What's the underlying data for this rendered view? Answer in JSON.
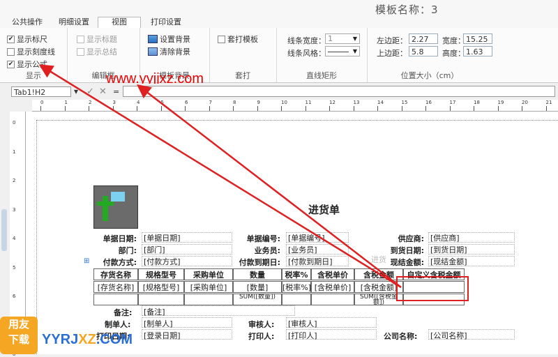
{
  "window": {
    "title": "模板名称：3"
  },
  "tabs": [
    {
      "label": "公共操作",
      "active": false
    },
    {
      "label": "明细设置",
      "active": false
    },
    {
      "label": "视图",
      "active": true
    },
    {
      "label": "打印设置",
      "active": false
    }
  ],
  "ribbon": {
    "display": {
      "label": "显示",
      "show_ruler": "显示标尺",
      "show_scale_line": "显示刻度线",
      "show_formula": "显示公式",
      "show_title": "显示标题",
      "show_summary": "显示总结"
    },
    "edit": {
      "label": "编辑框"
    },
    "bg": {
      "label": "模板背景",
      "set_bg": "设置背景",
      "clear_bg": "清除背景"
    },
    "overlay": {
      "label": "套打",
      "overlay_template": "套打模板"
    },
    "lines": {
      "label": "直线矩形",
      "width_label": "线条宽度：",
      "width_value": "1",
      "style_label": "线条风格："
    },
    "position": {
      "label": "位置大小（cm）",
      "left_label": "左边距：",
      "left_value": "2.27",
      "width_label": "宽度：",
      "width_value": "15.25",
      "top_label": "上边距：",
      "top_value": "5.8",
      "height_label": "高度：",
      "height_value": "1.63"
    }
  },
  "formula_bar": {
    "cell_ref": "Tab1!H2",
    "eq": "="
  },
  "ruler": {
    "h_ticks": [
      "0",
      "1",
      "2",
      "3",
      "4",
      "5",
      "6",
      "7",
      "8",
      "9",
      "10",
      "11",
      "12",
      "13",
      "14",
      "15",
      "16",
      "17",
      "18",
      "19",
      "20",
      "21"
    ],
    "v_ticks": [
      "0",
      "1",
      "2",
      "3",
      "4",
      "5",
      "6",
      "7",
      "8"
    ]
  },
  "watermark": "www.yyjjxz.com",
  "doc": {
    "title": "进货单",
    "row1": [
      "单据日期:",
      "[单据日期]",
      "单据编号:",
      "[单据编号]",
      "供应商:",
      "[供应商]"
    ],
    "row2": [
      "部门:",
      "[部门]",
      "业务员:",
      "[业务员]",
      "到货日期:",
      "[到货日期]"
    ],
    "row3": [
      "付款方式:",
      "[付款方式]",
      "付款到期日:",
      "[付款到期日]",
      "现结金额:",
      "[现结金额]"
    ],
    "headers": [
      "存货名称",
      "规格型号",
      "采购单位",
      "数量",
      "税率%",
      "含税单价",
      "含税金额",
      "自定义含税金额"
    ],
    "detail": [
      "[存货名称]",
      "[规格型号]",
      "[采购单位]",
      "[数量]",
      "[税率%]",
      "[含税单价]",
      "[含税金额]",
      ""
    ],
    "sum1": "SUM([数量])",
    "sum2": "SUM([含税金额])",
    "ghost_text": "进货",
    "note_label": "备注:",
    "note_value": "[备注]",
    "maker_label": "制单人:",
    "maker_value": "[制单人]",
    "auditor_label": "审核人:",
    "auditor_value": "[审核人]",
    "print_date_label": "打印日期:",
    "print_date_value": "[登录日期]",
    "printer_label": "打印人:",
    "printer_value": "[打印人]",
    "company_label": "公司名称:",
    "company_value": "[公司名称]"
  },
  "brand": {
    "logo_top": "用友",
    "logo_bottom": "下载",
    "site_a": "YYRJ",
    "site_b": "XZ",
    "site_c": ".COM"
  },
  "colors": {
    "accent": "#e02020",
    "brand": "#f5a623"
  }
}
